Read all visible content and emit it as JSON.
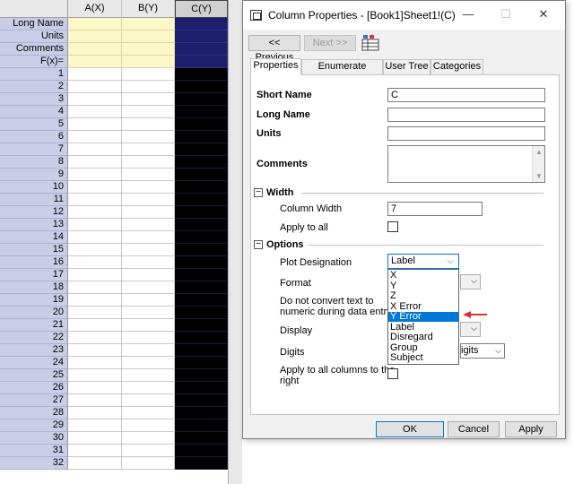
{
  "sheet": {
    "columns": [
      "A(X)",
      "B(Y)",
      "C(Y)"
    ],
    "meta_rows": [
      "Long Name",
      "Units",
      "Comments",
      "F(x)="
    ],
    "row_numbers": [
      "1",
      "2",
      "3",
      "4",
      "5",
      "6",
      "7",
      "8",
      "9",
      "10",
      "11",
      "12",
      "13",
      "14",
      "15",
      "16",
      "17",
      "18",
      "19",
      "20",
      "21",
      "22",
      "23",
      "24",
      "25",
      "26",
      "27",
      "28",
      "29",
      "30",
      "31",
      "32"
    ],
    "colors": {
      "meta_fill": "#fbf7c6",
      "selected_col": "#000000",
      "selected_meta": "#1c1f6e",
      "row_header": "#c9cde6"
    }
  },
  "dialog": {
    "title": "Column Properties - [Book1]Sheet1!(C)",
    "window_buttons": {
      "minimize": "—",
      "maximize": "☐",
      "close": "✕"
    },
    "toolbar": {
      "previous": "<< Previous",
      "next": "Next >>"
    },
    "tabs": [
      "Properties",
      "Enumerate Labels",
      "User Tree",
      "Categories"
    ],
    "fields": {
      "short_name_label": "Short Name",
      "short_name_value": "C",
      "long_name_label": "Long Name",
      "long_name_value": "",
      "units_label": "Units",
      "units_value": "",
      "comments_label": "Comments"
    },
    "width_section": {
      "title": "Width",
      "column_width_label": "Column Width",
      "column_width_value": "7",
      "apply_all_label": "Apply to all"
    },
    "options_section": {
      "title": "Options",
      "plot_designation_label": "Plot Designation",
      "plot_designation_value": "Label",
      "format_label": "Format",
      "no_convert_label_1": "Do not convert text to",
      "no_convert_label_2": "numeric during data entry",
      "display_label": "Display",
      "digits_label": "Digits",
      "digits_partial": "igits",
      "apply_right_label_1": "Apply to all columns to the",
      "apply_right_label_2": "right"
    },
    "dropdown_options": [
      "X",
      "Y",
      "Z",
      "X Error",
      "Y Error",
      "Label",
      "Disregard",
      "Group",
      "Subject"
    ],
    "dropdown_selected": "Y Error",
    "buttons": {
      "ok": "OK",
      "cancel": "Cancel",
      "apply": "Apply"
    },
    "accent_color": "#0078d7",
    "annotation_arrow_color": "#e0302a"
  }
}
